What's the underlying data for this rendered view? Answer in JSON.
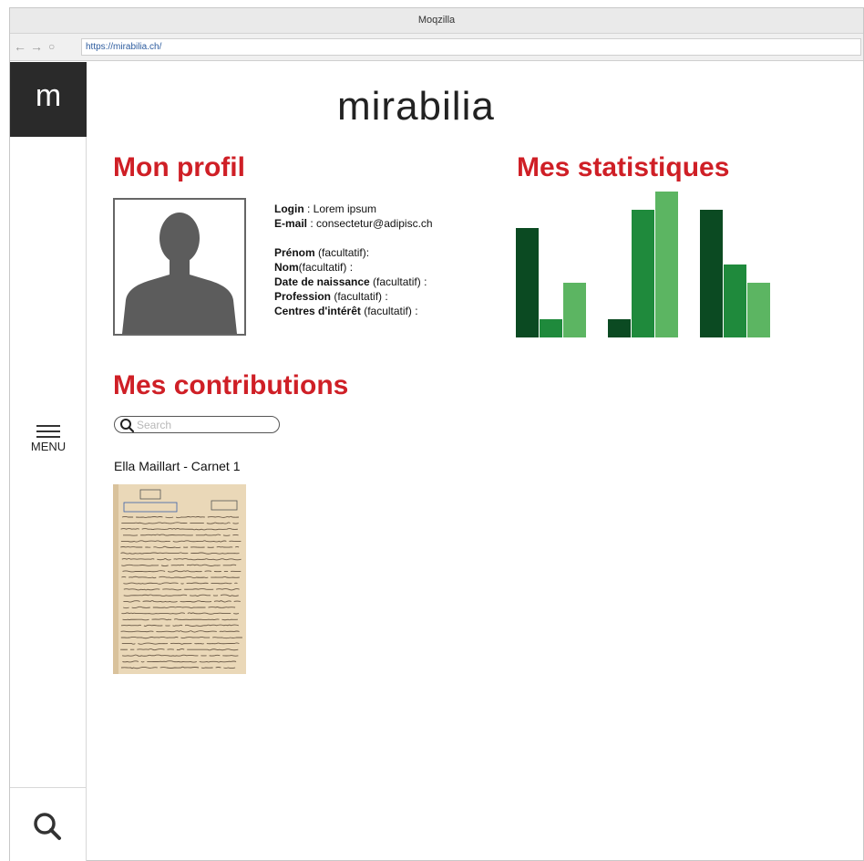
{
  "browser": {
    "title": "Moqzilla",
    "url": "https://mirabilia.ch/",
    "back_icon": "←",
    "forward_icon": "→",
    "reload_icon": "○"
  },
  "sidebar": {
    "logo_letter": "m",
    "menu_label": "MENU"
  },
  "brand": "mirabilia",
  "profile": {
    "heading": "Mon profil",
    "fields": [
      {
        "label": "Login",
        "value": " : Lorem ipsum"
      },
      {
        "label": "E-mail",
        "value": " : consectetur@adipisc.ch"
      },
      {
        "label": "Prénom",
        "value": " (facultatif):"
      },
      {
        "label": "Nom",
        "value": "(facultatif) :"
      },
      {
        "label": "Date de naissance",
        "value": " (facultatif) :"
      },
      {
        "label": "Profession",
        "value": " (facultatif) :"
      },
      {
        "label": "Centres d'intérêt",
        "value": " (facultatif) :"
      }
    ]
  },
  "stats": {
    "heading": "Mes statistiques"
  },
  "contributions": {
    "heading": "Mes contributions",
    "search_placeholder": "Search",
    "items": [
      {
        "title": "Ella Maillart - Carnet 1"
      }
    ]
  },
  "chart_data": {
    "type": "bar",
    "categories": [
      "",
      "",
      ""
    ],
    "series": [
      {
        "values": [
          6,
          1,
          7
        ],
        "color": "#0b4a22"
      },
      {
        "values": [
          1,
          7,
          4
        ],
        "color": "#1f8a3c"
      },
      {
        "values": [
          3,
          8,
          3
        ],
        "color": "#5cb562"
      }
    ],
    "ylim": [
      0,
      8
    ],
    "grid": false
  },
  "colors": {
    "heading_red": "#cf1f26",
    "sidebar_dark": "#2a2a2a"
  }
}
